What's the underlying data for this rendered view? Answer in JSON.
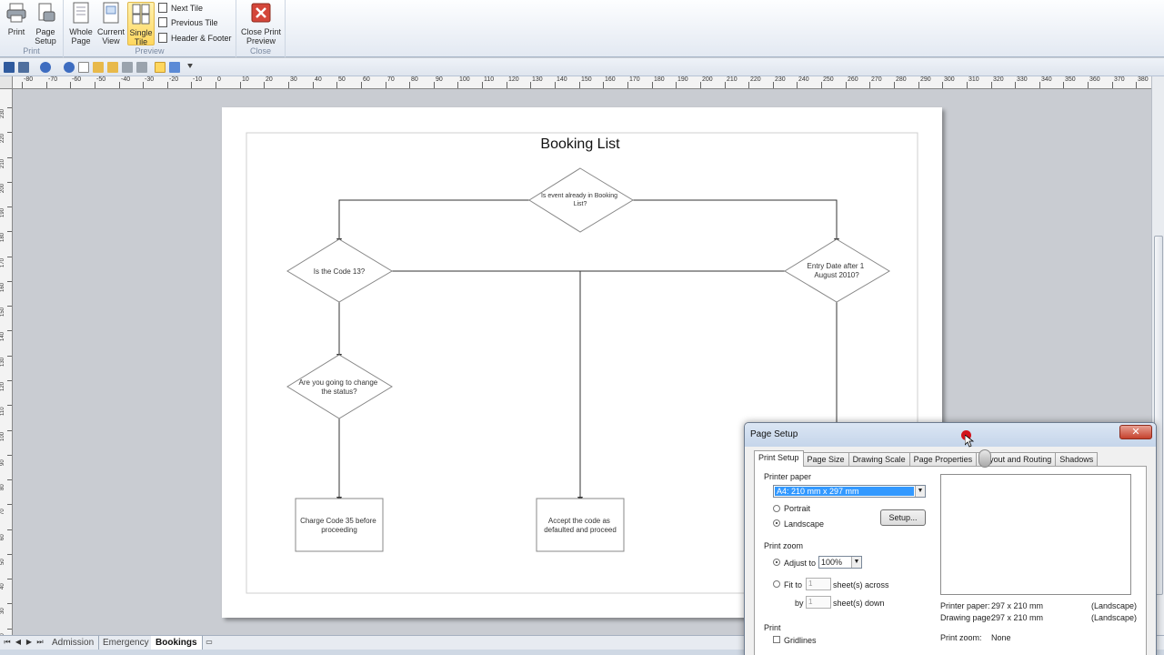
{
  "ribbon": {
    "print": "Print",
    "page_setup_line1": "Page",
    "page_setup_line2": "Setup",
    "group_print": "Print",
    "whole_page_line1": "Whole",
    "whole_page_line2": "Page",
    "current_view_line1": "Current",
    "current_view_line2": "View",
    "single_tile_line1": "Single",
    "single_tile_line2": "Tile",
    "next_tile": "Next Tile",
    "previous_tile": "Previous Tile",
    "header_footer": "Header & Footer",
    "group_preview": "Preview",
    "close_line1": "Close Print",
    "close_line2": "Preview",
    "group_close": "Close"
  },
  "ruler": {
    "h_ticks": [
      "-80",
      "-70",
      "-60",
      "-50",
      "-40",
      "-30",
      "-20",
      "-10",
      "0",
      "10",
      "20",
      "30",
      "40",
      "50",
      "60",
      "70",
      "80",
      "90",
      "100",
      "110",
      "120",
      "130",
      "140",
      "150",
      "160",
      "170",
      "180",
      "190",
      "200",
      "210",
      "220",
      "230",
      "240",
      "250",
      "260",
      "270",
      "280",
      "290",
      "300",
      "310",
      "320",
      "330",
      "340",
      "350",
      "360",
      "370",
      "380"
    ],
    "v_ticks": [
      "230",
      "220",
      "210",
      "200",
      "190",
      "180",
      "170",
      "160",
      "150",
      "140",
      "130",
      "120",
      "110",
      "100",
      "90",
      "80",
      "70",
      "60",
      "50",
      "40",
      "30",
      "20"
    ]
  },
  "diagram": {
    "title": "Booking List",
    "nodes": {
      "top": [
        "Is event already in Booking",
        "List?"
      ],
      "left": [
        "Is the Code 13?"
      ],
      "right": [
        "Entry Date after 1",
        "August 2010?"
      ],
      "mid": [
        "Are you going to change",
        "the status?"
      ],
      "box1": [
        "Charge Code 35 before",
        "proceeding"
      ],
      "box2": [
        "Accept the code as",
        "defaulted and proceed"
      ]
    }
  },
  "sheets": {
    "tabs": [
      "Admission",
      "Emergency",
      "Bookings"
    ],
    "active": "Bookings"
  },
  "dialog": {
    "title": "Page Setup",
    "close": "✕",
    "tabs": [
      "Print Setup",
      "Page Size",
      "Drawing Scale",
      "Page Properties",
      "Layout and Routing",
      "Shadows"
    ],
    "printer_paper_label": "Printer paper",
    "paper_value": "A4:  210 mm x 297 mm",
    "portrait": "Portrait",
    "landscape": "Landscape",
    "setup_button": "Setup...",
    "print_zoom_label": "Print zoom",
    "adjust_to": "Adjust to",
    "zoom_value": "100%",
    "fit_to": "Fit to",
    "fit_across_value": "1",
    "sheets_across": "sheet(s) across",
    "by": "by",
    "fit_down_value": "1",
    "sheets_down": "sheet(s) down",
    "print_label": "Print",
    "gridlines": "Gridlines",
    "printer_paper_info_label": "Printer paper:",
    "printer_paper_info_value": "297 x 210 mm",
    "printer_paper_info_orient": "(Landscape)",
    "drawing_page_label": "Drawing page:",
    "drawing_page_value": "297 x 210 mm",
    "drawing_page_orient": "(Landscape)",
    "print_zoom_info_label": "Print zoom:",
    "print_zoom_info_value": "None"
  }
}
